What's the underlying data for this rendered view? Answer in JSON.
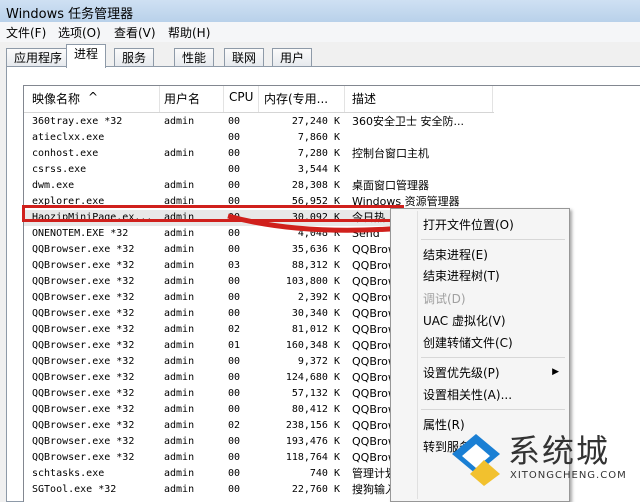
{
  "window": {
    "title": "Windows 任务管理器"
  },
  "menu": [
    "文件(F)",
    "选项(O)",
    "查看(V)",
    "帮助(H)"
  ],
  "tabs": [
    {
      "label": "应用程序",
      "active": false
    },
    {
      "label": "进程",
      "active": true
    },
    {
      "label": "服务",
      "active": false
    },
    {
      "label": "性能",
      "active": false
    },
    {
      "label": "联网",
      "active": false
    },
    {
      "label": "用户",
      "active": false
    }
  ],
  "columns": {
    "name": "映像名称",
    "user": "用户名",
    "cpu": "CPU",
    "mem": "内存(专用...",
    "desc": "描述"
  },
  "rows": [
    {
      "name": "360tray.exe *32",
      "user": "admin",
      "cpu": "00",
      "mem": "27,240 K",
      "desc": "360安全卫士 安全防..."
    },
    {
      "name": "atieclxx.exe",
      "user": "",
      "cpu": "00",
      "mem": "7,860 K",
      "desc": ""
    },
    {
      "name": "conhost.exe",
      "user": "admin",
      "cpu": "00",
      "mem": "7,280 K",
      "desc": "控制台窗口主机"
    },
    {
      "name": "csrss.exe",
      "user": "",
      "cpu": "00",
      "mem": "3,544 K",
      "desc": ""
    },
    {
      "name": "dwm.exe",
      "user": "admin",
      "cpu": "00",
      "mem": "28,308 K",
      "desc": "桌面窗口管理器"
    },
    {
      "name": "explorer.exe",
      "user": "admin",
      "cpu": "00",
      "mem": "56,952 K",
      "desc": "Windows 资源管理器"
    },
    {
      "name": "HaozipMiniPage.ex...",
      "user": "admin",
      "cpu": "00",
      "mem": "30,092 K",
      "desc": "今日热..."
    },
    {
      "name": "ONENOTEM.EXE *32",
      "user": "admin",
      "cpu": "00",
      "mem": "4,048 K",
      "desc": "Send"
    },
    {
      "name": "QQBrowser.exe *32",
      "user": "admin",
      "cpu": "00",
      "mem": "35,636 K",
      "desc": "QQBrow"
    },
    {
      "name": "QQBrowser.exe *32",
      "user": "admin",
      "cpu": "03",
      "mem": "88,312 K",
      "desc": "QQBrow"
    },
    {
      "name": "QQBrowser.exe *32",
      "user": "admin",
      "cpu": "00",
      "mem": "103,800 K",
      "desc": "QQBrow"
    },
    {
      "name": "QQBrowser.exe *32",
      "user": "admin",
      "cpu": "00",
      "mem": "2,392 K",
      "desc": "QQBrow"
    },
    {
      "name": "QQBrowser.exe *32",
      "user": "admin",
      "cpu": "00",
      "mem": "30,340 K",
      "desc": "QQBrow"
    },
    {
      "name": "QQBrowser.exe *32",
      "user": "admin",
      "cpu": "02",
      "mem": "81,012 K",
      "desc": "QQBrow"
    },
    {
      "name": "QQBrowser.exe *32",
      "user": "admin",
      "cpu": "01",
      "mem": "160,348 K",
      "desc": "QQBrow"
    },
    {
      "name": "QQBrowser.exe *32",
      "user": "admin",
      "cpu": "00",
      "mem": "9,372 K",
      "desc": "QQBrow"
    },
    {
      "name": "QQBrowser.exe *32",
      "user": "admin",
      "cpu": "00",
      "mem": "124,680 K",
      "desc": "QQBrow"
    },
    {
      "name": "QQBrowser.exe *32",
      "user": "admin",
      "cpu": "00",
      "mem": "57,132 K",
      "desc": "QQBrow"
    },
    {
      "name": "QQBrowser.exe *32",
      "user": "admin",
      "cpu": "00",
      "mem": "80,412 K",
      "desc": "QQBrow"
    },
    {
      "name": "QQBrowser.exe *32",
      "user": "admin",
      "cpu": "02",
      "mem": "238,156 K",
      "desc": "QQBrow"
    },
    {
      "name": "QQBrowser.exe *32",
      "user": "admin",
      "cpu": "00",
      "mem": "193,476 K",
      "desc": "QQBrow"
    },
    {
      "name": "QQBrowser.exe *32",
      "user": "admin",
      "cpu": "00",
      "mem": "118,764 K",
      "desc": "QQBrow"
    },
    {
      "name": "schtasks.exe",
      "user": "admin",
      "cpu": "00",
      "mem": "740 K",
      "desc": "管理计划任务"
    },
    {
      "name": "SGTool.exe *32",
      "user": "admin",
      "cpu": "00",
      "mem": "22,760 K",
      "desc": "搜狗输入法 工具"
    }
  ],
  "context_menu": {
    "open_location": "打开文件位置(O)",
    "end_process": "结束进程(E)",
    "end_tree": "结束进程树(T)",
    "debug": "调试(D)",
    "uac": "UAC 虚拟化(V)",
    "dump": "创建转储文件(C)",
    "priority": "设置优先级(P)",
    "affinity": "设置相关性(A)...",
    "properties": "属性(R)",
    "goto_service": "转到服务"
  },
  "watermark": {
    "brand": "系统城",
    "url": "XITONGCHENG.COM"
  },
  "colors": {
    "highlight": "#d0201c",
    "accent": "#1a7fd4"
  }
}
